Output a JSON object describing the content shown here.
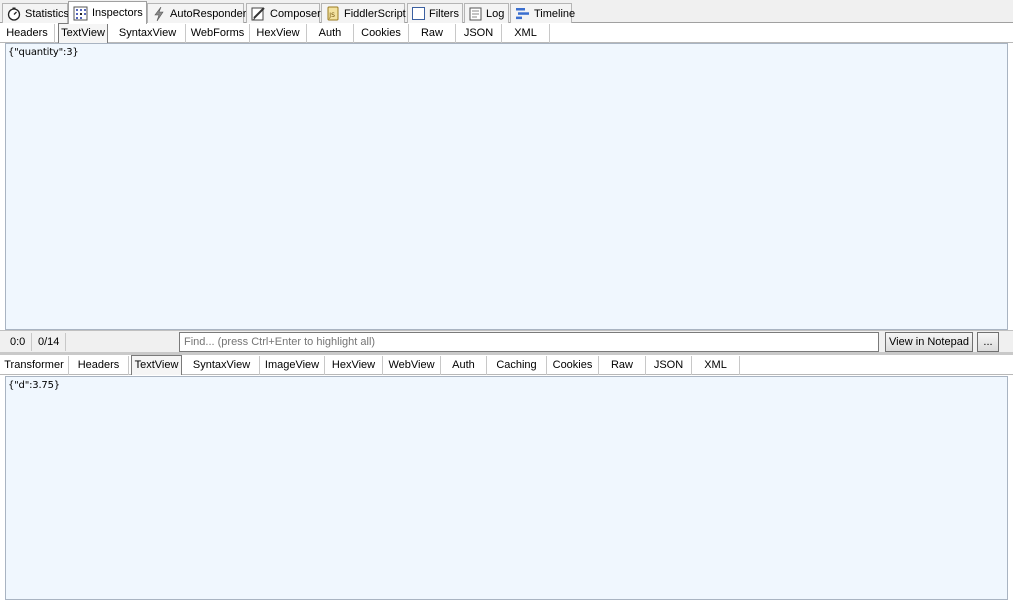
{
  "main_tabs": [
    {
      "label": "Statistics",
      "icon": "stopwatch-icon"
    },
    {
      "label": "Inspectors",
      "icon": "inspectors-grid-icon"
    },
    {
      "label": "AutoResponder",
      "icon": "lightning-icon"
    },
    {
      "label": "Composer",
      "icon": "pencil-page-icon"
    },
    {
      "label": "FiddlerScript",
      "icon": "script-icon"
    },
    {
      "label": "Filters",
      "icon": "checkbox-icon"
    },
    {
      "label": "Log",
      "icon": "log-page-icon"
    },
    {
      "label": "Timeline",
      "icon": "timeline-bars-icon"
    }
  ],
  "request": {
    "tabs": [
      "Headers",
      "TextView",
      "SyntaxView",
      "WebForms",
      "HexView",
      "Auth",
      "Cookies",
      "Raw",
      "JSON",
      "XML"
    ],
    "active_tab": "TextView",
    "body": "{\"quantity\":3}"
  },
  "find_bar": {
    "position": "0:0",
    "count": "0/14",
    "placeholder": "Find... (press Ctrl+Enter to highlight all)",
    "notepad_button": "View in Notepad",
    "more_button": "..."
  },
  "response": {
    "tabs": [
      "Transformer",
      "Headers",
      "TextView",
      "SyntaxView",
      "ImageView",
      "HexView",
      "WebView",
      "Auth",
      "Caching",
      "Cookies",
      "Raw",
      "JSON",
      "XML"
    ],
    "active_tab": "TextView",
    "body": "{\"d\":3.75}"
  }
}
